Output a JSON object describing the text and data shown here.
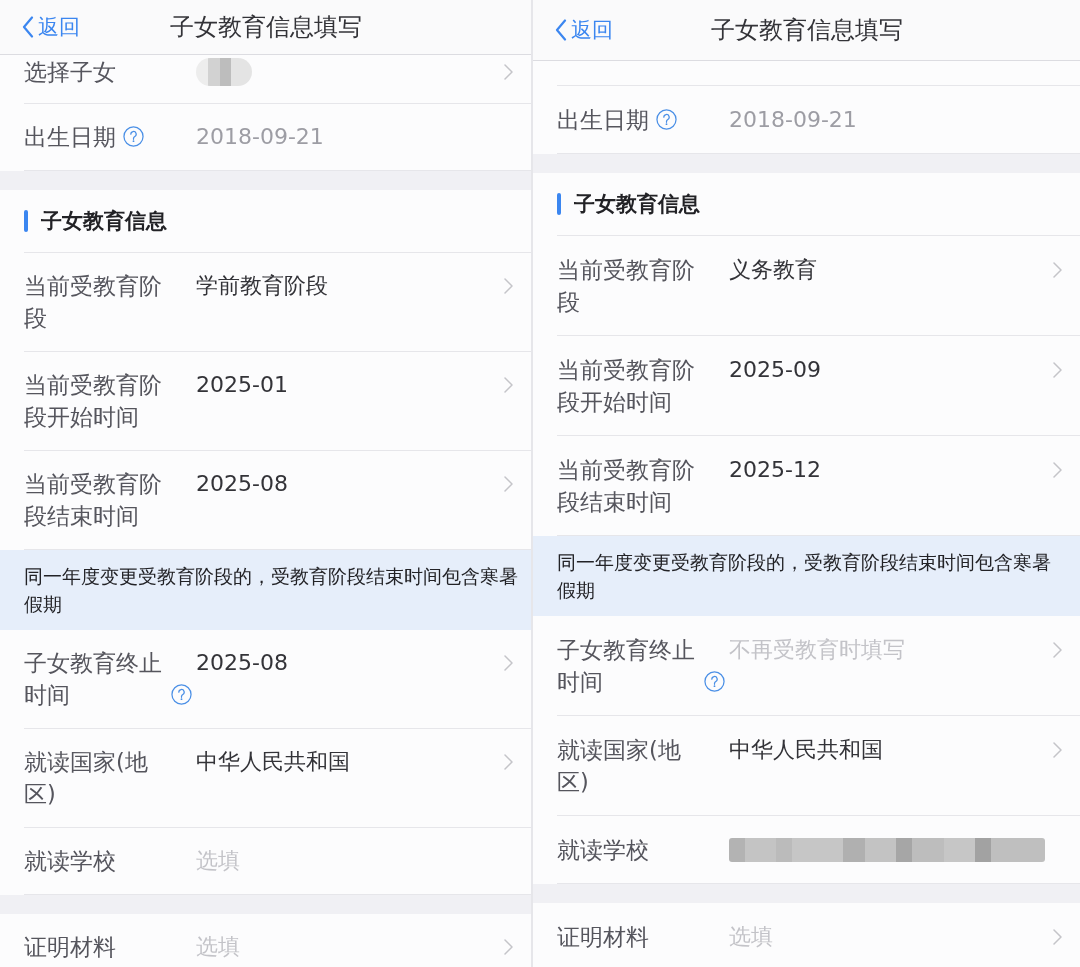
{
  "screens": [
    {
      "nav": {
        "back": "返回",
        "title": "子女教育信息填写"
      },
      "rows": [
        {
          "kind": "field",
          "label": "选择子女",
          "redacted": true,
          "help": false,
          "chevron": true
        },
        {
          "kind": "field",
          "label": "出生日期",
          "value": "2018-09-21",
          "readonly": true,
          "redacted": false,
          "help": true,
          "chevron": false
        },
        {
          "kind": "gap"
        },
        {
          "kind": "section",
          "title": "子女教育信息"
        },
        {
          "kind": "field",
          "label": "当前受教育阶段",
          "value": "学前教育阶段",
          "readonly": false,
          "redacted": false,
          "help": false,
          "chevron": true
        },
        {
          "kind": "field",
          "label": "当前受教育阶段开始时间",
          "value": "2025-01",
          "readonly": false,
          "redacted": false,
          "help": false,
          "chevron": true
        },
        {
          "kind": "field",
          "label": "当前受教育阶段结束时间",
          "value": "2025-08",
          "readonly": false,
          "redacted": false,
          "help": false,
          "chevron": true
        },
        {
          "kind": "notice",
          "text": "同一年度变更受教育阶段的，受教育阶段结束时间包含寒暑假期"
        },
        {
          "kind": "field",
          "label": "子女教育终止时间",
          "value": "2025-08",
          "readonly": false,
          "redacted": false,
          "help": true,
          "chevron": true
        },
        {
          "kind": "field",
          "label": "就读国家(地区)",
          "value": "中华人民共和国",
          "readonly": false,
          "redacted": false,
          "help": false,
          "chevron": true
        },
        {
          "kind": "field",
          "label": "就读学校",
          "placeholder": "选填",
          "redacted": false,
          "help": false,
          "chevron": false
        },
        {
          "kind": "gap"
        },
        {
          "kind": "field",
          "label": "证明材料",
          "placeholder": "选填",
          "redacted": false,
          "help": false,
          "chevron": true
        }
      ]
    },
    {
      "nav": {
        "back": "返回",
        "title": "子女教育信息填写"
      },
      "rows": [
        {
          "kind": "clipped"
        },
        {
          "kind": "field",
          "label": "出生日期",
          "value": "2018-09-21",
          "readonly": true,
          "redacted": false,
          "help": true,
          "chevron": false
        },
        {
          "kind": "gap"
        },
        {
          "kind": "section",
          "title": "子女教育信息"
        },
        {
          "kind": "field",
          "label": "当前受教育阶段",
          "value": "义务教育",
          "readonly": false,
          "redacted": false,
          "help": false,
          "chevron": true
        },
        {
          "kind": "field",
          "label": "当前受教育阶段开始时间",
          "value": "2025-09",
          "readonly": false,
          "redacted": false,
          "help": false,
          "chevron": true
        },
        {
          "kind": "field",
          "label": "当前受教育阶段结束时间",
          "value": "2025-12",
          "readonly": false,
          "redacted": false,
          "help": false,
          "chevron": true
        },
        {
          "kind": "notice",
          "text": "同一年度变更受教育阶段的，受教育阶段结束时间包含寒暑假期"
        },
        {
          "kind": "field",
          "label": "子女教育终止时间",
          "placeholder": "不再受教育时填写",
          "redacted": false,
          "help": true,
          "chevron": true
        },
        {
          "kind": "field",
          "label": "就读国家(地区)",
          "value": "中华人民共和国",
          "readonly": false,
          "redacted": false,
          "help": false,
          "chevron": true
        },
        {
          "kind": "field",
          "label": "就读学校",
          "redacted": true,
          "help": false,
          "chevron": false
        },
        {
          "kind": "gap"
        },
        {
          "kind": "field",
          "label": "证明材料",
          "placeholder": "选填",
          "redacted": false,
          "help": false,
          "chevron": true
        }
      ]
    }
  ]
}
